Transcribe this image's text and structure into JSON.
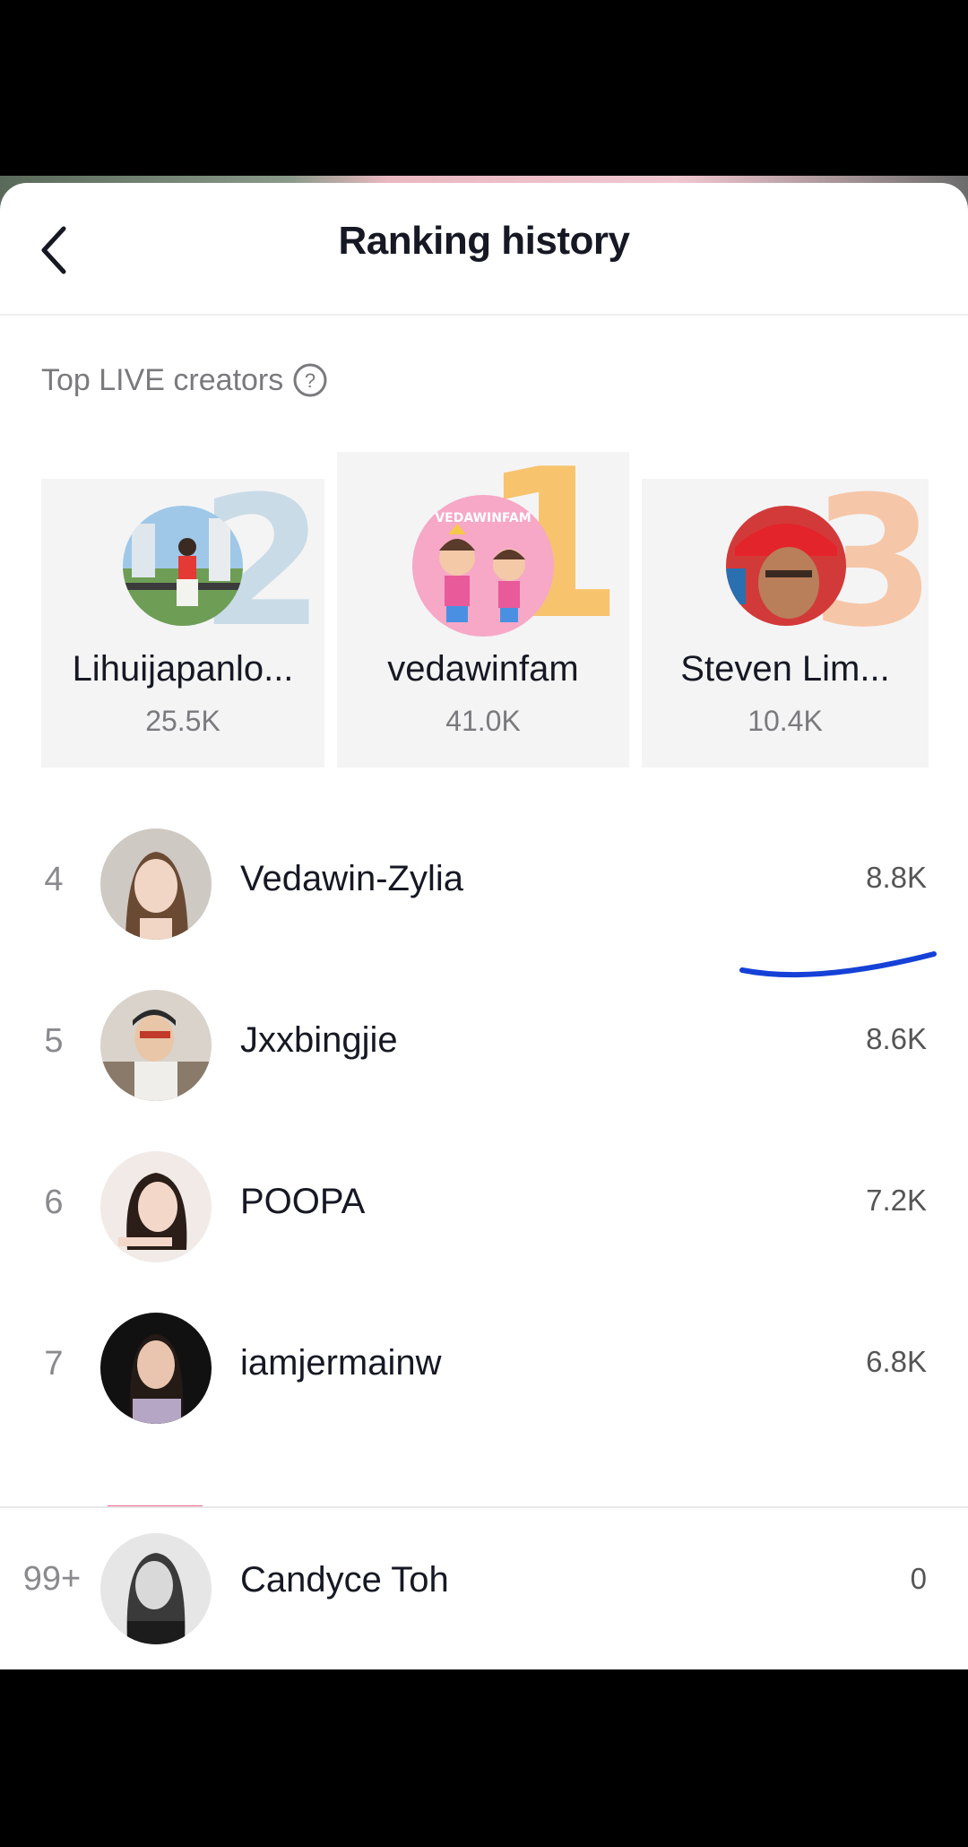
{
  "header": {
    "title": "Ranking history"
  },
  "section": {
    "label": "Top LIVE creators"
  },
  "podium": [
    {
      "rank": "2",
      "name": "Lihuijapanlo...",
      "score": "25.5K",
      "rank_color": "#c9dbe6"
    },
    {
      "rank": "1",
      "name": "vedawinfam",
      "score": "41.0K",
      "rank_color": "#f7c36c"
    },
    {
      "rank": "3",
      "name": "Steven Lim...",
      "score": "10.4K",
      "rank_color": "#f6c6a8"
    }
  ],
  "list": [
    {
      "rank": "4",
      "name": "Vedawin-Zylia",
      "score": "8.8K"
    },
    {
      "rank": "5",
      "name": "Jxxbingjie",
      "score": "8.6K"
    },
    {
      "rank": "6",
      "name": "POOPA",
      "score": "7.2K"
    },
    {
      "rank": "7",
      "name": "iamjermainw",
      "score": "6.8K"
    }
  ],
  "self": {
    "rank": "99+",
    "name": "Candyce Toh",
    "score": "0"
  },
  "colors": {
    "annotation": "#1541d6",
    "text_primary": "#161823",
    "text_secondary": "#7a7a7e"
  }
}
